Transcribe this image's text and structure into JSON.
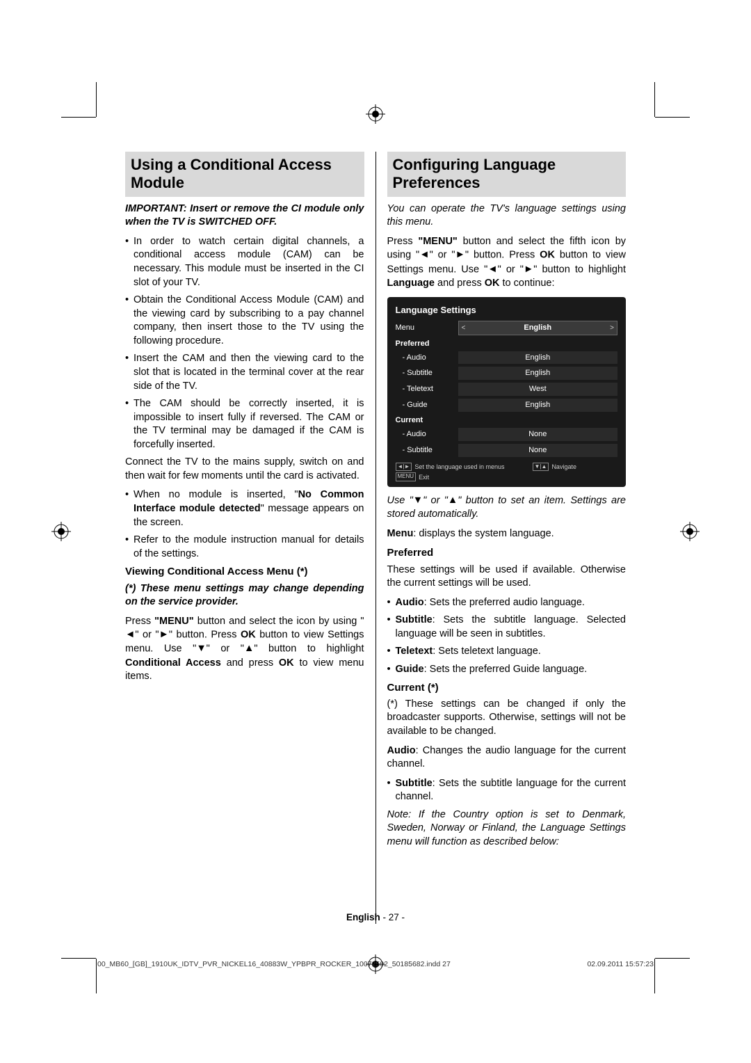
{
  "left": {
    "title": "Using a Conditional Access Module",
    "important": "IMPORTANT: Insert or remove the CI module only when the TV is SWITCHED OFF.",
    "b1": "In order to watch certain digital channels, a conditional access module (CAM) can be necessary. This module must be inserted in the CI slot of your TV.",
    "b2": "Obtain the Conditional Access Module (CAM) and the viewing card by subscribing to a pay channel company, then insert those to the TV using the following procedure.",
    "b3": "Insert the CAM and then the viewing card to the slot that is located in the terminal cover at the rear side of the TV.",
    "b4": "The CAM should be correctly inserted, it is impossible to insert fully if reversed. The CAM or the TV terminal may be damaged if the CAM is forcefully inserted.",
    "p1": "Connect the TV to the mains supply, switch on and then wait for few moments until the card is activated.",
    "b5a": "When no module is inserted, \"",
    "b5b": "No Common Interface module detected",
    "b5c": "\" message appears on the screen.",
    "b6": "Refer to the module instruction manual for details of the settings.",
    "subh": "Viewing Conditional Access Menu (*)",
    "note": "(*) These menu settings may change depending on the service provider.",
    "p2a": "Press ",
    "p2b": "\"MENU\"",
    "p2c": " button and select the icon by using \"",
    "p2d": "\" or \"",
    "p2e": "\" button. Press ",
    "p2f": "OK",
    "p2g": " button to view Settings menu. Use \"",
    "p2h": "\" or \"",
    "p2i": "\" button to highlight ",
    "p2j": "Conditional Access",
    "p2k": " and press ",
    "p2l": "OK",
    "p2m": " to view menu items."
  },
  "right": {
    "title": "Configuring Language Preferences",
    "intro": "You can operate the TV's language settings using this menu.",
    "p1a": "Press ",
    "p1b": "\"MENU\"",
    "p1c": " button and select the fifth icon by using \"",
    "p1d": "\" or \"",
    "p1e": "\" button. Press ",
    "p1f": "OK",
    "p1g": " button to view Settings menu. Use \"",
    "p1h": "\" or \"",
    "p1i": "\" button to highlight ",
    "p1j": "Language",
    "p1k": " and press ",
    "p1l": "OK",
    "p1m": " to continue:",
    "tv": {
      "title": "Language Settings",
      "menu_label": "Menu",
      "menu_value": "English",
      "preferred": "Preferred",
      "audio_label": "- Audio",
      "audio_value": "English",
      "subtitle_label": "- Subtitle",
      "subtitle_value": "English",
      "teletext_label": "- Teletext",
      "teletext_value": "West",
      "guide_label": "- Guide",
      "guide_value": "English",
      "current": "Current",
      "caudio_label": "- Audio",
      "caudio_value": "None",
      "csubtitle_label": "- Subtitle",
      "csubtitle_value": "None",
      "f1": "Set the language used in menus",
      "f2": "Navigate",
      "f3": "Exit"
    },
    "p2a": "Use \"",
    "p2b": "\" or \"",
    "p2c": "\" button to set an item. Settings are stored automatically.",
    "menu_desc_a": "Menu",
    "menu_desc_b": ": displays the system language.",
    "pref_h": "Preferred",
    "pref_desc": "These settings will be used if available. Otherwise the current settings will be used.",
    "pb1a": "Audio",
    "pb1b": ": Sets the preferred audio language.",
    "pb2a": "Subtitle",
    "pb2b": ": Sets the subtitle language. Selected language will be seen in subtitles.",
    "pb3a": "Teletext",
    "pb3b": ": Sets teletext language.",
    "pb4a": "Guide",
    "pb4b": ": Sets the preferred Guide language.",
    "cur_h": "Current (*)",
    "cur_desc": "(*) These settings can be changed if only the broadcaster supports. Otherwise, settings will not be available to be changed.",
    "caudio_a": "Audio",
    "caudio_b": ": Changes the audio language for the current channel.",
    "cb1a": "Subtitle",
    "cb1b": ": Sets the subtitle language for the current channel.",
    "note": "Note: If the Country option is set to Denmark, Sweden, Norway or Finland, the Language Settings menu will function as described below:"
  },
  "footer": {
    "lang": "English",
    "page": "   - 27 -"
  },
  "docfooter": {
    "file": "00_MB60_[GB]_1910UK_IDTV_PVR_NICKEL16_40883W_YPBPR_ROCKER_10072502_50185682.indd   27",
    "date": "02.09.2011   15:57:23"
  }
}
